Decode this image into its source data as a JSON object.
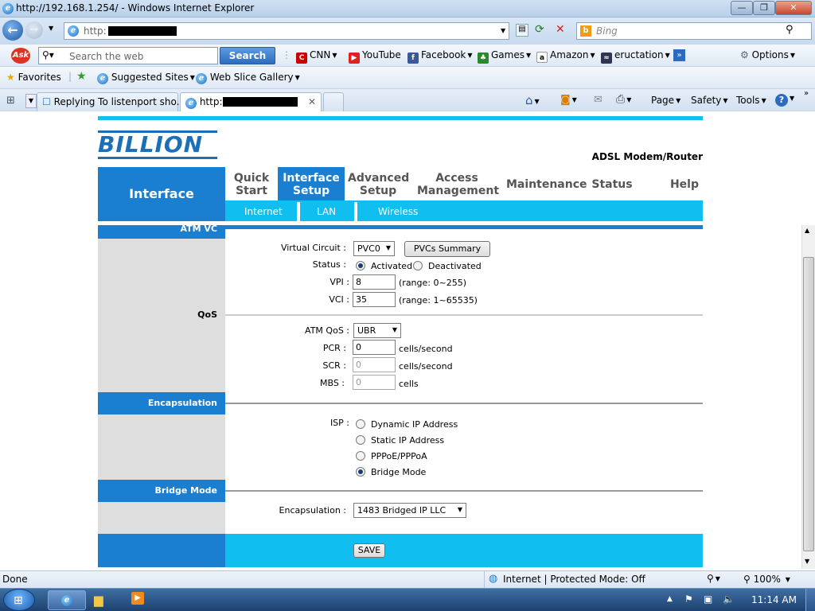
{
  "window": {
    "title": "http://192.168.1.254/ - Windows Internet Explorer"
  },
  "address": {
    "url_prefix": "http:",
    "search_placeholder": "Bing"
  },
  "toolbar": {
    "ask_placeholder": "Search the web",
    "search_button": "Search",
    "links": [
      "CNN",
      "YouTube",
      "Facebook",
      "Games",
      "Amazon",
      "eructation"
    ],
    "options": "Options"
  },
  "favorites": {
    "label": "Favorites",
    "suggested": "Suggested Sites",
    "webslice": "Web Slice Gallery"
  },
  "tabs": [
    {
      "label": "Replying To listenport sho..."
    },
    {
      "label": "http:/"
    }
  ],
  "commandbar": {
    "page": "Page",
    "safety": "Safety",
    "tools": "Tools"
  },
  "router": {
    "brand": "BILLION",
    "product": "ADSL Modem/Router",
    "section_title": "Interface",
    "nav": [
      "Quick Start",
      "Interface Setup",
      "Advanced Setup",
      "Access Management",
      "Maintenance",
      "Status",
      "Help"
    ],
    "subnav": [
      "Internet",
      "LAN",
      "Wireless"
    ],
    "sections": {
      "atmvc": "ATM VC",
      "qos": "QoS",
      "encap": "Encapsulation",
      "bridge": "Bridge Mode"
    },
    "form": {
      "virtual_circuit_label": "Virtual Circuit :",
      "virtual_circuit_value": "PVC0",
      "pvcs_button": "PVCs Summary",
      "status_label": "Status :",
      "status_activated": "Activated",
      "status_deactivated": "Deactivated",
      "vpi_label": "VPI :",
      "vpi_value": "8",
      "vpi_range": "(range: 0~255)",
      "vci_label": "VCI :",
      "vci_value": "35",
      "vci_range": "(range: 1~65535)",
      "atm_qos_label": "ATM QoS :",
      "atm_qos_value": "UBR",
      "pcr_label": "PCR :",
      "pcr_value": "0",
      "scr_label": "SCR :",
      "scr_value": "0",
      "mbs_label": "MBS :",
      "mbs_value": "0",
      "cells_second": "cells/second",
      "cells": "cells",
      "isp_label": "ISP :",
      "isp_options": [
        "Dynamic IP Address",
        "Static IP Address",
        "PPPoE/PPPoA",
        "Bridge Mode"
      ],
      "encapsulation_label": "Encapsulation :",
      "encapsulation_value": "1483 Bridged IP LLC",
      "save_button": "SAVE"
    }
  },
  "status": {
    "left": "Done",
    "zone": "Internet | Protected Mode: Off",
    "zoom": "100%"
  },
  "taskbar": {
    "time": "11:14 AM"
  }
}
